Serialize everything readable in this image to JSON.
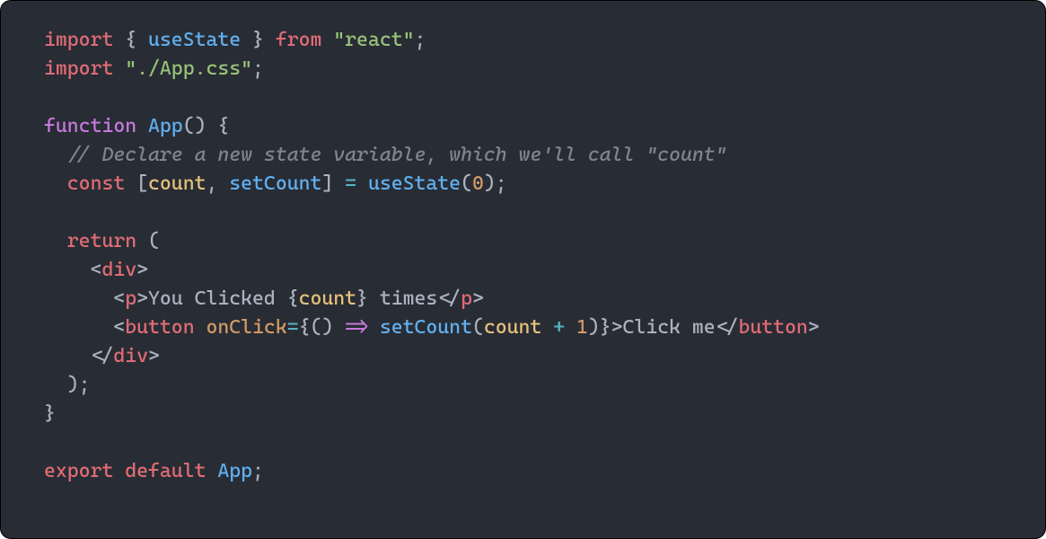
{
  "code": {
    "l1": {
      "import": "import",
      "lb": "{",
      "useState": "useState",
      "rb": "}",
      "from": "from",
      "react": "\"react\"",
      "semi": ";"
    },
    "l2": {
      "import": "import",
      "css": "\"./App.css\"",
      "semi": ";"
    },
    "l3": "",
    "l4": {
      "function": "function",
      "App": "App",
      "paren": "()",
      "brace": " {"
    },
    "l5": {
      "comment": "// Declare a new state variable, which we'll call \"count\""
    },
    "l6": {
      "const": "const",
      "lb": "[",
      "count": "count",
      "comma": ",",
      "setCount": "setCount",
      "rb": "]",
      "eq": "=",
      "useState": "useState",
      "lp": "(",
      "zero": "0",
      "rp": ")",
      "semi": ";"
    },
    "l7": "",
    "l8": {
      "return": "return",
      "lp": " ("
    },
    "l9": {
      "lt": "<",
      "div": "div",
      "gt": ">"
    },
    "l10": {
      "lt": "<",
      "p": "p",
      "gt": ">",
      "t1": "You Clicked ",
      "lb": "{",
      "count": "count",
      "rb": "}",
      "t2": " times",
      "lt2": "</",
      "p2": "p",
      "gt2": ">"
    },
    "l11": {
      "lt": "<",
      "button": "button",
      "sp": " ",
      "onClick": "onClick",
      "eq": "=",
      "lb": "{",
      "lp": "()",
      "arrow": " => ",
      "setCount": "setCount",
      "lp2": "(",
      "count": "count",
      "plus": " + ",
      "one": "1",
      "rp2": ")",
      "rb": "}",
      "gt": ">",
      "txt": "Click me",
      "lt2": "</",
      "button2": "button",
      "gt2": ">"
    },
    "l12": {
      "lt": "</",
      "div": "div",
      "gt": ">"
    },
    "l13": {
      "rp": ");"
    },
    "l14": {
      "rb": "}"
    },
    "l15": "",
    "l16": {
      "export": "export",
      "default": "default",
      "App": "App",
      "semi": ";"
    }
  }
}
